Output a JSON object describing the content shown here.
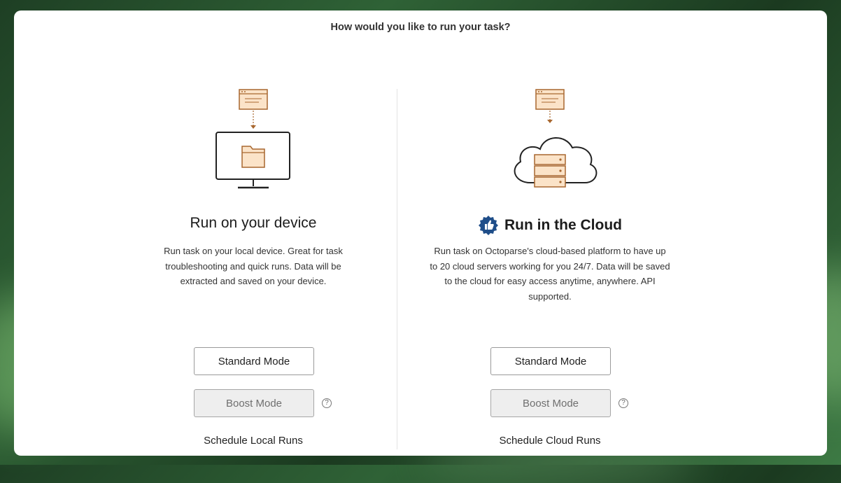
{
  "dialog": {
    "title": "How would you like to run your task?"
  },
  "local": {
    "heading": "Run on your device",
    "description_lines": [
      "Run task on your local device. Great for task",
      "troubleshooting and quick runs. Data will be",
      "extracted and saved on your device."
    ],
    "standard_label": "Standard Mode",
    "boost_label": "Boost Mode",
    "help_glyph": "?",
    "schedule_label": "Schedule Local Runs",
    "illustration": "monitor-folder-icon"
  },
  "cloud": {
    "heading": "Run in the Cloud",
    "badge_icon": "thumbs-up-badge-icon",
    "description_lines": [
      "Run task on Octoparse's cloud-based platform to have up",
      "to 20 cloud servers working for you 24/7. Data will be saved",
      "to the cloud for easy access anytime, anywhere. API",
      "supported."
    ],
    "standard_label": "Standard Mode",
    "boost_label": "Boost Mode",
    "help_glyph": "?",
    "schedule_label": "Schedule Cloud Runs",
    "illustration": "cloud-server-icon"
  },
  "colors": {
    "accent_orange": "#a8672f",
    "icon_fill": "#fbe3c8",
    "badge_blue": "#1f4e89",
    "disabled_bg": "#eeeeee"
  }
}
